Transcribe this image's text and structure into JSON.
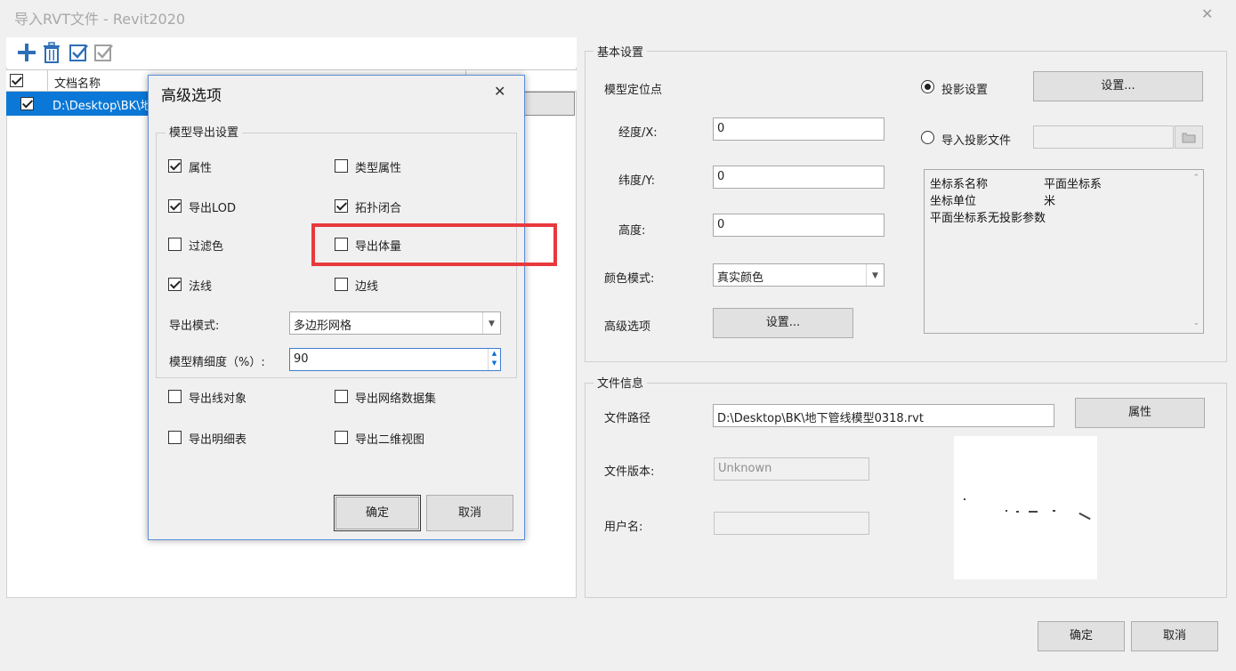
{
  "window": {
    "title": "导入RVT文件 - Revit2020",
    "close_glyph": "✕"
  },
  "list": {
    "header": "文档名称",
    "rows": [
      {
        "path": "D:\\Desktop\\BK\\地"
      }
    ]
  },
  "basic": {
    "group_title": "基本设置",
    "origin_label": "模型定位点",
    "lon_label": "经度/X:",
    "lon_value": "0",
    "lat_label": "纬度/Y:",
    "lat_value": "0",
    "height_label": "高度:",
    "height_value": "0",
    "color_mode_label": "颜色模式:",
    "color_mode_value": "真实颜色",
    "advanced_label": "高级选项",
    "advanced_button": "设置...",
    "projection_setting_label": "投影设置",
    "projection_setting_button": "设置...",
    "import_projection_label": "导入投影文件",
    "import_projection_value": "",
    "info_lines": [
      {
        "key": "坐标系名称",
        "value": "平面坐标系"
      },
      {
        "key": "坐标单位",
        "value": "米"
      },
      {
        "key": "平面坐标系无投影参数",
        "value": ""
      }
    ]
  },
  "file_info": {
    "group_title": "文件信息",
    "path_label": "文件路径",
    "path_value": "D:\\Desktop\\BK\\地下管线模型0318.rvt",
    "properties_button": "属性",
    "version_label": "文件版本:",
    "version_value": "Unknown",
    "user_label": "用户名:",
    "user_value": ""
  },
  "footer": {
    "ok": "确定",
    "cancel": "取消"
  },
  "dialog": {
    "title": "高级选项",
    "group_title": "模型导出设置",
    "options": {
      "attr": {
        "label": "属性",
        "checked": true
      },
      "type_attr": {
        "label": "类型属性",
        "checked": false
      },
      "export_lod": {
        "label": "导出LOD",
        "checked": true
      },
      "topo_close": {
        "label": "拓扑闭合",
        "checked": true
      },
      "filter_color": {
        "label": "过滤色",
        "checked": false
      },
      "export_volume": {
        "label": "导出体量",
        "checked": false
      },
      "normal": {
        "label": "法线",
        "checked": true
      },
      "edge": {
        "label": "边线",
        "checked": false
      },
      "export_lines": {
        "label": "导出线对象",
        "checked": false
      },
      "export_network": {
        "label": "导出网络数据集",
        "checked": false
      },
      "export_schedule": {
        "label": "导出明细表",
        "checked": false
      },
      "export_2d": {
        "label": "导出二维视图",
        "checked": false
      }
    },
    "mode_label": "导出模式:",
    "mode_value": "多边形网格",
    "precision_label": "模型精细度（%）:",
    "precision_value": "90",
    "ok": "确定",
    "cancel": "取消"
  },
  "icons": {
    "add": "plus-icon",
    "delete": "trash-icon",
    "check_all": "check-all-icon",
    "uncheck": "check-gray-icon"
  },
  "colors": {
    "selection": "#0b78d7",
    "highlight": "#e8393c",
    "accent_blue": "#1f6fc2"
  }
}
